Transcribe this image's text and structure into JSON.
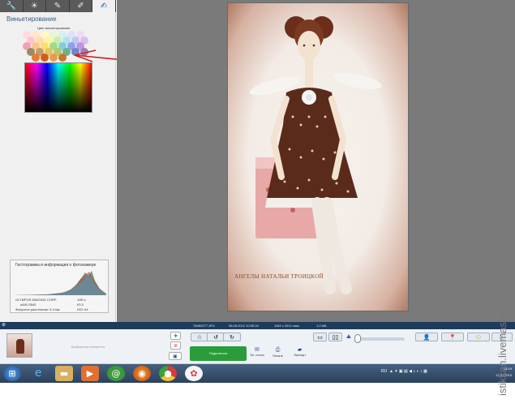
{
  "left_panel": {
    "tabs": [
      {
        "icon": "wrench-icon",
        "glyph": "🔧"
      },
      {
        "icon": "sun-icon",
        "glyph": "☀"
      },
      {
        "icon": "brush-icon",
        "glyph": "✎"
      },
      {
        "icon": "pen-paper-icon",
        "glyph": "✐"
      },
      {
        "icon": "edit-sheet-icon",
        "glyph": "✍"
      }
    ],
    "title": "Виньетирование",
    "swatch_caption": "Цвет виньетирования",
    "swatches": [
      "#ffd9e4",
      "#ffe7c9",
      "#fff7c7",
      "#e8f6d1",
      "#d6f0f2",
      "#dde3fb",
      "#eedcf7",
      "#ffc3cf",
      "#ffdcb0",
      "#fff3a1",
      "#c9ecb0",
      "#b3e3ea",
      "#bfcaf4",
      "#dcbdee",
      "#f2a0b6",
      "#f6c58b",
      "#ffe066",
      "#9fdc87",
      "#7fcfd8",
      "#8ea2ea",
      "#c193e0",
      "#9a8a6a",
      "#c79a6a",
      "#e8c160",
      "#b8c66a",
      "#6fb08a",
      "#6f86c6",
      "#9c7fb8",
      "#e87b2f",
      "#d35b1a",
      "#e89b4f",
      "#c47a2a"
    ],
    "histogram": {
      "title": "Гистограмма и информация о фотокамере",
      "camera_make": "OLYMPUS IMAGING CORP.",
      "shutter": "1/50 с",
      "model": "u840,S840",
      "aperture": "f/3.3",
      "focal": "Фокусное расстояние: 6.4 мм",
      "iso": "ISO: 64"
    }
  },
  "photo": {
    "caption": "АНГЕЛЫ НАТАЛЬИ ТРОИЦКОЙ"
  },
  "status_bar": {
    "filename": "76082377.JPG",
    "date": "08.08.2012 10:05:15",
    "size": "1163 x 2011 пикс.",
    "filesize": "1,0 МБ"
  },
  "tray": {
    "selected_label": "Выбранные элементы",
    "share": "Поделиться",
    "email": "Эл. почта",
    "print": "Печать",
    "export": "Экспорт"
  },
  "taskbar": {
    "lang": "RU",
    "time": "14:19",
    "date": "17.07.2013"
  },
  "watermark": "istikkan.livemaster.ru"
}
